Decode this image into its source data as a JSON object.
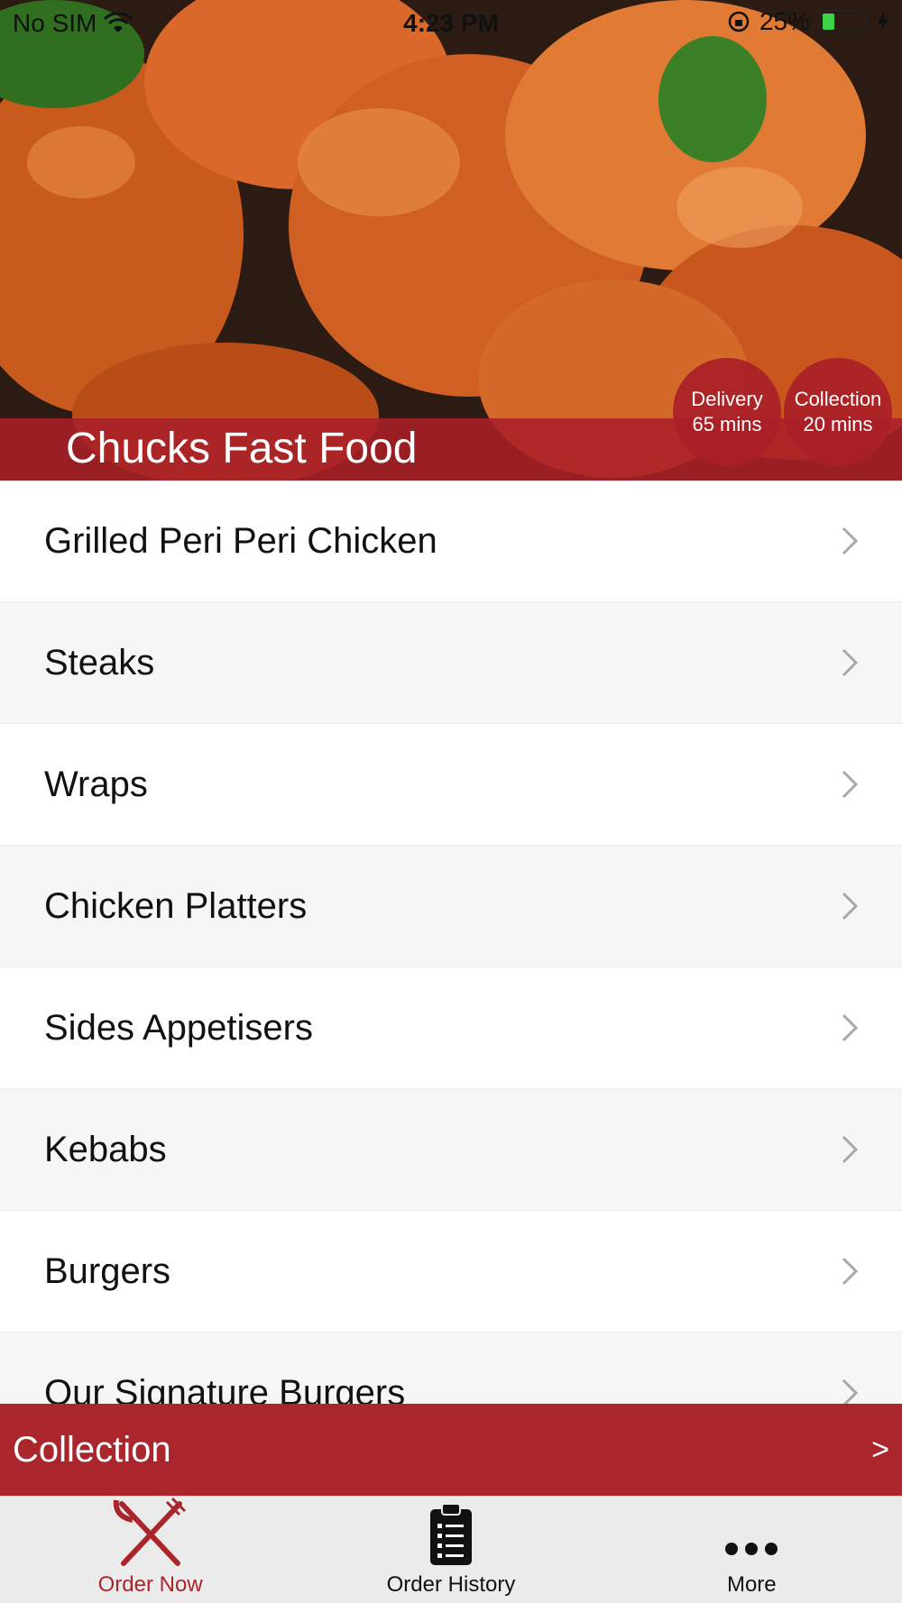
{
  "status_bar": {
    "carrier": "No SIM",
    "time": "4:23 PM",
    "battery_percent": "25%",
    "battery_level": 0.25
  },
  "hero": {
    "restaurant_name": "Chucks Fast Food",
    "delivery": {
      "label": "Delivery",
      "time": "65 mins"
    },
    "collection": {
      "label": "Collection",
      "time": "20 mins"
    }
  },
  "menu": {
    "items": [
      {
        "label": "Grilled Peri Peri Chicken"
      },
      {
        "label": "Steaks"
      },
      {
        "label": "Wraps"
      },
      {
        "label": "Chicken Platters"
      },
      {
        "label": "Sides Appetisers"
      },
      {
        "label": "Kebabs"
      },
      {
        "label": "Burgers"
      },
      {
        "label": "Our Signature Burgers"
      }
    ]
  },
  "collection_bar": {
    "label": "Collection",
    "arrow": ">"
  },
  "tab_bar": {
    "tabs": [
      {
        "label": "Order Now",
        "icon": "fork-knife-icon",
        "active": true
      },
      {
        "label": "Order History",
        "icon": "clipboard-list-icon",
        "active": false
      },
      {
        "label": "More",
        "icon": "more-dots-icon",
        "active": false
      }
    ]
  },
  "colors": {
    "brand_red": "#ab252c",
    "tab_bar_bg": "#ebebeb",
    "active_tab": "#ab252c"
  }
}
